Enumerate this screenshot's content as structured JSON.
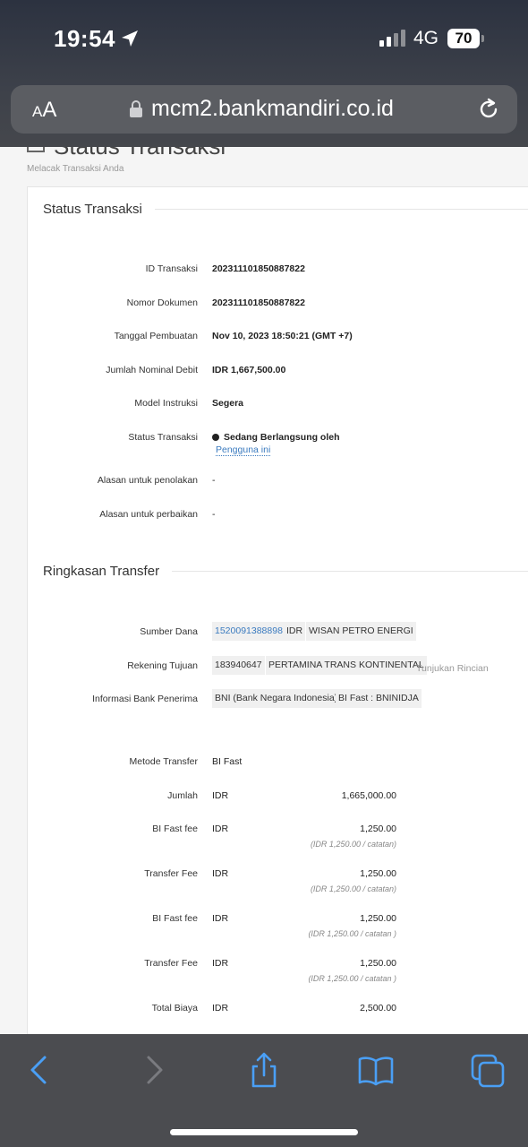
{
  "status_bar": {
    "time": "19:54",
    "network": "4G",
    "battery": "70",
    "icons": [
      "location-arrow-icon",
      "signal-icon",
      "battery-icon"
    ]
  },
  "browser": {
    "text_size_label": "AA",
    "url": "mcm2.bankmandiri.co.id",
    "icons": [
      "lock-icon",
      "reload-icon"
    ]
  },
  "page": {
    "title": "Status Transaksi",
    "subtitle": "Melacak Transaksi Anda"
  },
  "status_section": {
    "title": "Status Transaksi",
    "rows": [
      {
        "label": "ID Transaksi",
        "value": "202311101850887822"
      },
      {
        "label": "Nomor Dokumen",
        "value": "202311101850887822"
      },
      {
        "label": "Tanggal Pembuatan",
        "value": "Nov 10, 2023 18:50:21 (GMT +7)"
      },
      {
        "label": "Jumlah Nominal Debit",
        "value": "IDR 1,667,500.00"
      },
      {
        "label": "Model Instruksi",
        "value": "Segera"
      },
      {
        "label": "Status Transaksi",
        "value": "Sedang Berlangsung oleh",
        "link": "Pengguna ini"
      },
      {
        "label": "Alasan untuk penolakan",
        "value": "-"
      },
      {
        "label": "Alasan untuk perbaikan",
        "value": "-"
      }
    ]
  },
  "transfer_section": {
    "title": "Ringkasan Transfer",
    "source_label": "Sumber Dana",
    "source_account": "1520091388898",
    "source_currency": "IDR",
    "source_name": "WISAN PETRO ENERGI",
    "dest_label": "Rekening Tujuan",
    "dest_account": "183940647",
    "dest_name": "PERTAMINA TRANS KONTINENTAL",
    "dest_detail_link": "Tunjukan Rincian",
    "bank_label": "Informasi Bank Penerima",
    "bank_name": "BNI (Bank Negara Indonesia)",
    "bank_code": "BI Fast : BNINIDJA",
    "method_label": "Metode Transfer",
    "method_value": "BI Fast",
    "amounts": [
      {
        "label": "Jumlah",
        "currency": "IDR",
        "amount": "1,665,000.00",
        "note": ""
      },
      {
        "label": "BI Fast fee",
        "currency": "IDR",
        "amount": "1,250.00",
        "note": "(IDR 1,250.00 / catatan)"
      },
      {
        "label": "Transfer Fee",
        "currency": "IDR",
        "amount": "1,250.00",
        "note": "(IDR 1,250.00 / catatan)"
      },
      {
        "label": "BI Fast fee",
        "currency": "IDR",
        "amount": "1,250.00",
        "note": "(IDR 1,250.00 / catatan )"
      },
      {
        "label": "Transfer Fee",
        "currency": "IDR",
        "amount": "1,250.00",
        "note": "(IDR 1,250.00 / catatan )"
      },
      {
        "label": "Total Biaya",
        "currency": "IDR",
        "amount": "2,500.00",
        "note": ""
      }
    ]
  },
  "toolbar": {
    "icons": [
      "back-icon",
      "forward-icon",
      "share-icon",
      "bookmarks-icon",
      "tabs-icon"
    ]
  }
}
